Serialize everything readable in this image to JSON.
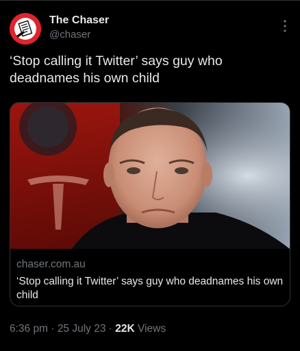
{
  "account": {
    "display_name": "The Chaser",
    "handle": "@chaser",
    "avatar_icon": "chaser-logo-icon",
    "avatar_color": "#e0242b"
  },
  "tweet": {
    "text": "‘Stop calling it Twitter’ says guy who deadnames his own child"
  },
  "card": {
    "domain": "chaser.com.au",
    "title": "‘Stop calling it Twitter’ says guy who deadnames his own child",
    "image_icon": "article-photo"
  },
  "meta": {
    "time": "6:36 pm",
    "separator": "·",
    "date": "25 July 23",
    "views_count": "22K",
    "views_label": "Views"
  },
  "menu": {
    "icon": "more-options-icon"
  }
}
